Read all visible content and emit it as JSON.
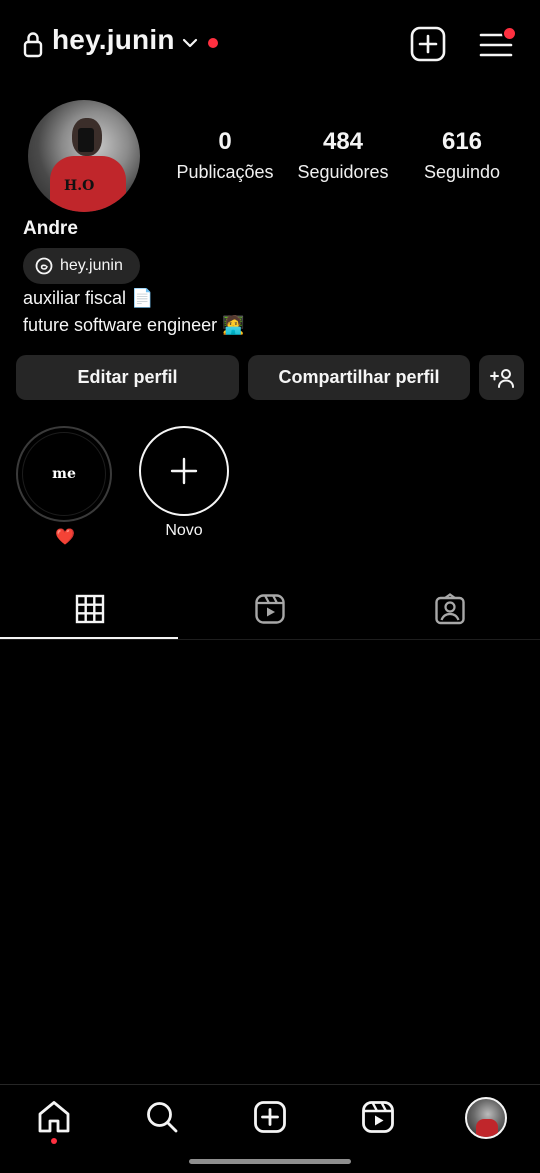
{
  "header": {
    "username": "hey.junin",
    "icons": [
      "lock-icon",
      "chevron-down-icon",
      "create-post-icon",
      "menu-icon"
    ],
    "notification_color": "#ff3040"
  },
  "profile": {
    "name": "Andre",
    "threads_handle": "hey.junin",
    "bio_line1": "auxiliar fiscal 📄",
    "bio_line2": "future software engineer 🧑‍💻",
    "stats": [
      {
        "value": "0",
        "label": "Publicações"
      },
      {
        "value": "484",
        "label": "Seguidores"
      },
      {
        "value": "616",
        "label": "Seguindo"
      }
    ]
  },
  "actions": {
    "edit_label": "Editar perfil",
    "share_label": "Compartilhar perfil",
    "discover_people_icon": "add-person-icon"
  },
  "highlights": [
    {
      "cover_text": "me",
      "title_emoji": "❤️"
    },
    {
      "label": "Novo",
      "icon": "plus-icon"
    }
  ],
  "tabs": [
    {
      "name": "grid-icon",
      "active": true
    },
    {
      "name": "reels-icon",
      "active": false
    },
    {
      "name": "tagged-icon",
      "active": false
    }
  ],
  "bottom_nav": [
    {
      "name": "home-icon",
      "active": true
    },
    {
      "name": "search-icon",
      "active": false
    },
    {
      "name": "create-icon",
      "active": false
    },
    {
      "name": "reels-icon",
      "active": false
    },
    {
      "name": "profile-avatar",
      "active": false
    }
  ],
  "colors": {
    "background": "#000000",
    "button_bg": "#262626",
    "accent_red": "#ff3040"
  }
}
